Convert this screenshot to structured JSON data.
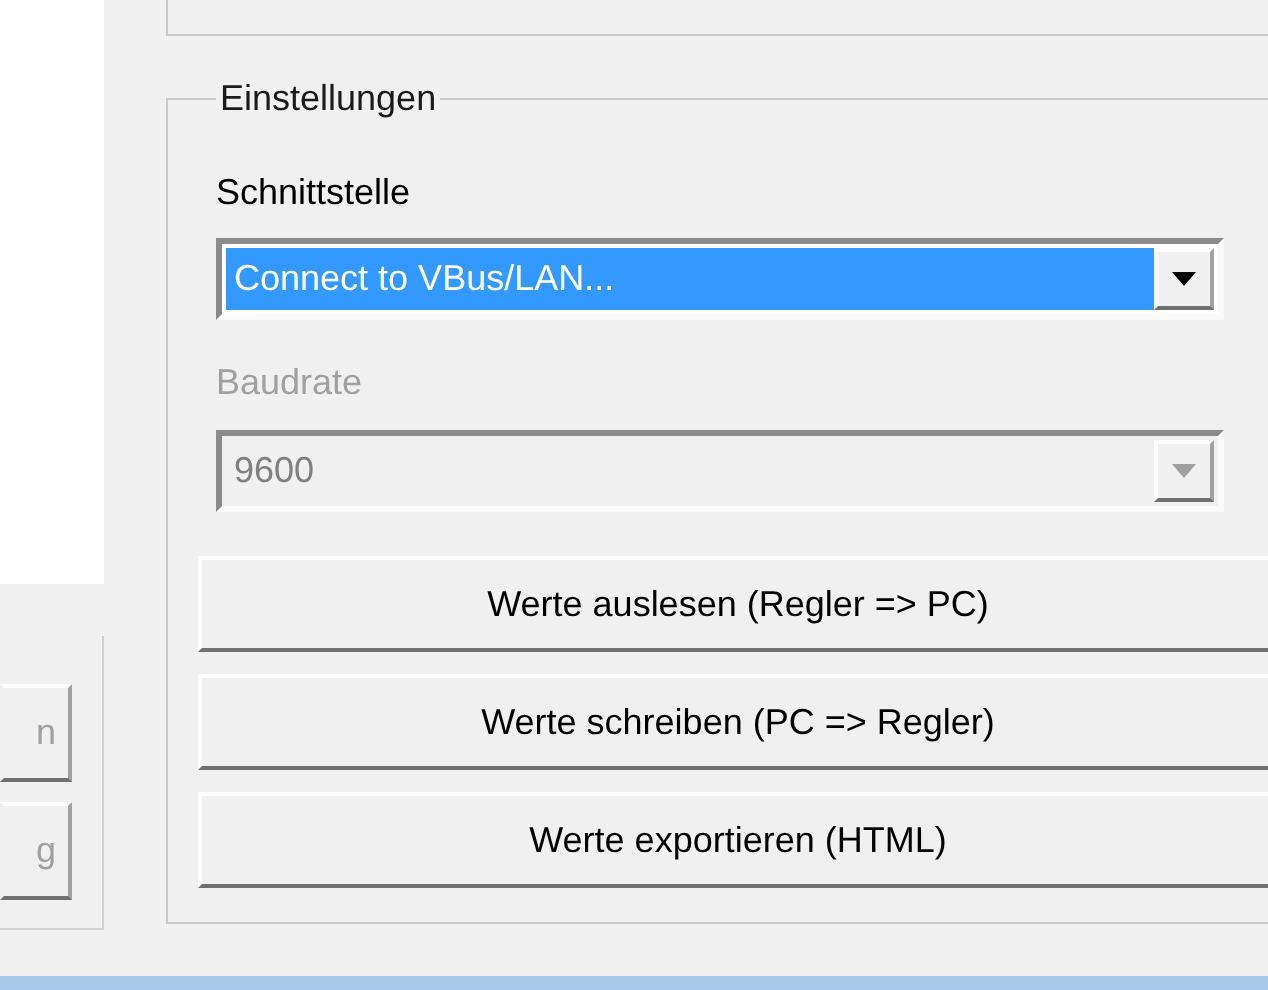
{
  "left_buttons": [
    {
      "label": "n",
      "disabled": true
    },
    {
      "label": "g",
      "disabled": true
    }
  ],
  "settings_group": {
    "title": "Einstellungen",
    "interface": {
      "label": "Schnittstelle",
      "value": "Connect to VBus/LAN...",
      "selected": true,
      "disabled": false
    },
    "baudrate": {
      "label": "Baudrate",
      "value": "9600",
      "selected": false,
      "disabled": true
    },
    "buttons": [
      {
        "label": "Werte auslesen (Regler => PC)"
      },
      {
        "label": "Werte schreiben (PC => Regler)"
      },
      {
        "label": "Werte exportieren (HTML)"
      }
    ]
  }
}
